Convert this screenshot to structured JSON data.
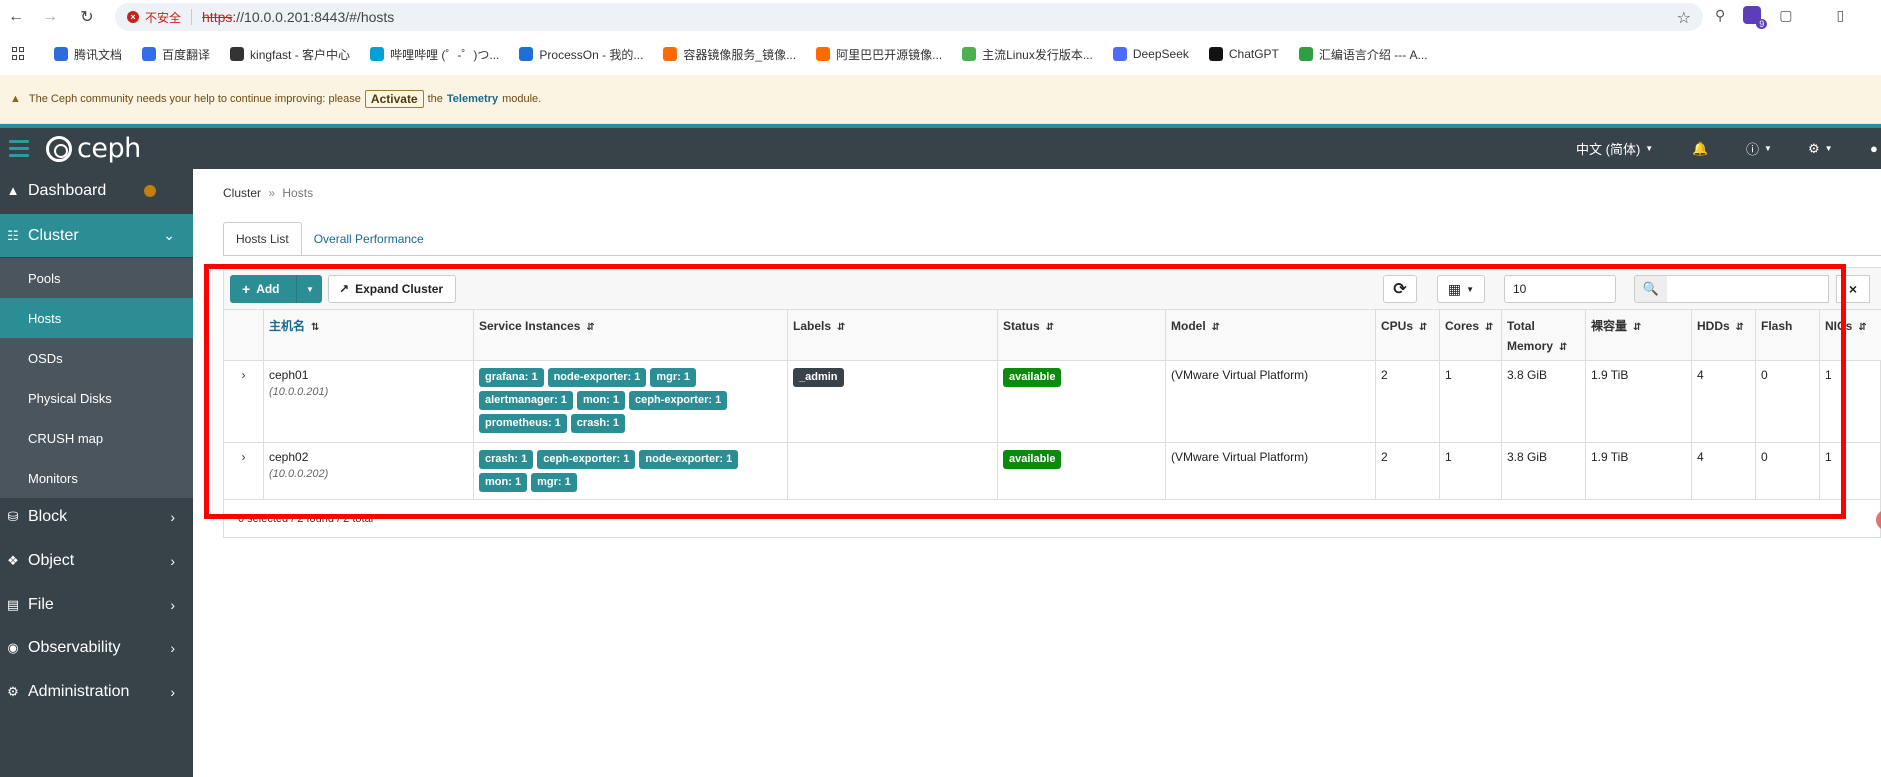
{
  "browser": {
    "insecure_label": "不安全",
    "url_scheme": "https",
    "url_rest": "://10.0.0.201:8443/#/hosts",
    "bookmarks": [
      {
        "label": "腾讯文档",
        "color": "#2b6cde"
      },
      {
        "label": "百度翻译",
        "color": "#2f6ee6"
      },
      {
        "label": "kingfast - 客户中心",
        "color": "#333333"
      },
      {
        "label": "哔哩哔哩 (゜-゜)つ...",
        "color": "#00a1d6"
      },
      {
        "label": "ProcessOn - 我的...",
        "color": "#1e6fd9"
      },
      {
        "label": "容器镜像服务_镜像...",
        "color": "#ff6a00"
      },
      {
        "label": "阿里巴巴开源镜像...",
        "color": "#ff6a00"
      },
      {
        "label": "主流Linux发行版本...",
        "color": "#4caf50"
      },
      {
        "label": "DeepSeek",
        "color": "#4d6bfe"
      },
      {
        "label": "ChatGPT",
        "color": "#111111"
      },
      {
        "label": "汇编语言介绍 --- A...",
        "color": "#2e9e3e"
      }
    ],
    "extension_badge": "9"
  },
  "notice": {
    "text_before": "The Ceph community needs your help to continue improving: please",
    "activate_label": "Activate",
    "text_middle": "the",
    "telemetry_link": "Telemetry",
    "text_after": "module."
  },
  "navbar": {
    "logo_text": "ceph",
    "language": "中文 (简体)"
  },
  "sidebar": {
    "dashboard": "Dashboard",
    "cluster": "Cluster",
    "cluster_items": [
      "Pools",
      "Hosts",
      "OSDs",
      "Physical Disks",
      "CRUSH map",
      "Monitors"
    ],
    "block": "Block",
    "object": "Object",
    "file": "File",
    "observability": "Observability",
    "administration": "Administration"
  },
  "breadcrumb": {
    "parent": "Cluster",
    "current": "Hosts"
  },
  "tabs": [
    "Hosts List",
    "Overall Performance"
  ],
  "toolbar": {
    "add_label": "Add",
    "expand_label": "Expand Cluster",
    "page_size": "10"
  },
  "table": {
    "columns": [
      "主机名",
      "Service Instances",
      "Labels",
      "Status",
      "Model",
      "CPUs",
      "Cores",
      "Total Memory",
      "裸容量",
      "HDDs",
      "Flash",
      "NICs"
    ],
    "rows": [
      {
        "hostname": "ceph01",
        "ip": "(10.0.0.201)",
        "services": [
          "grafana: 1",
          "node-exporter: 1",
          "mgr: 1",
          "alertmanager: 1",
          "mon: 1",
          "ceph-exporter: 1",
          "prometheus: 1",
          "crash: 1"
        ],
        "labels": [
          "_admin"
        ],
        "status": "available",
        "model": "(VMware Virtual Platform)",
        "cpus": "2",
        "cores": "1",
        "memory": "3.8 GiB",
        "raw_capacity": "1.9 TiB",
        "hdds": "4",
        "flash": "0",
        "nics": "1"
      },
      {
        "hostname": "ceph02",
        "ip": "(10.0.0.202)",
        "services": [
          "crash: 1",
          "ceph-exporter: 1",
          "node-exporter: 1",
          "mon: 1",
          "mgr: 1"
        ],
        "labels": [],
        "status": "available",
        "model": "(VMware Virtual Platform)",
        "cpus": "2",
        "cores": "1",
        "memory": "3.8 GiB",
        "raw_capacity": "1.9 TiB",
        "hdds": "4",
        "flash": "0",
        "nics": "1"
      }
    ],
    "footer": "0 selected / 2 found / 2 total"
  },
  "colors": {
    "accent": "#2b8e94",
    "sidebar_bg": "#374249",
    "status_available": "#0b8a0b",
    "highlight": "#ff0000"
  }
}
